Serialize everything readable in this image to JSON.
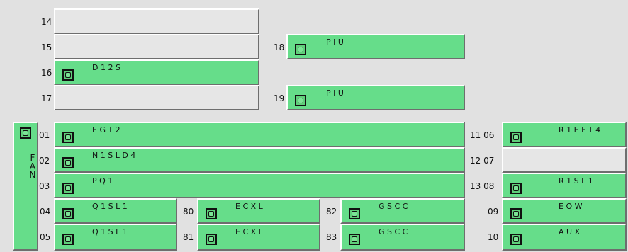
{
  "left_panel": {
    "slots": [
      {
        "num": "14"
      },
      {
        "num": "15"
      },
      {
        "num": "16",
        "label": "D 1 2 S"
      },
      {
        "num": "17"
      }
    ]
  },
  "piu": [
    {
      "num": "18",
      "label": "P I U"
    },
    {
      "num": "19",
      "label": "P I U"
    }
  ],
  "fan": {
    "letters": [
      "F",
      "A",
      "N"
    ]
  },
  "main_rows": [
    {
      "num": "01",
      "label": "E G T 2"
    },
    {
      "num": "02",
      "label": "N 1 S L D 4"
    },
    {
      "num": "03",
      "label": "P Q 1"
    }
  ],
  "grid": [
    {
      "num": "04",
      "label": "Q 1 S L 1"
    },
    {
      "num": "05",
      "label": "Q 1 S L 1"
    },
    {
      "num": "80",
      "label": "E C X L"
    },
    {
      "num": "81",
      "label": "E C X L"
    },
    {
      "num": "82",
      "label": "G S C C"
    },
    {
      "num": "83",
      "label": "G S C C"
    }
  ],
  "right_panel": [
    {
      "num": "11 06",
      "label": "R 1 E F T 4"
    },
    {
      "num": "12 07"
    },
    {
      "num": "13 08",
      "label": "R 1 S L 1"
    },
    {
      "num": "09",
      "label": "E O W"
    },
    {
      "num": "10",
      "label": "A U X"
    }
  ]
}
